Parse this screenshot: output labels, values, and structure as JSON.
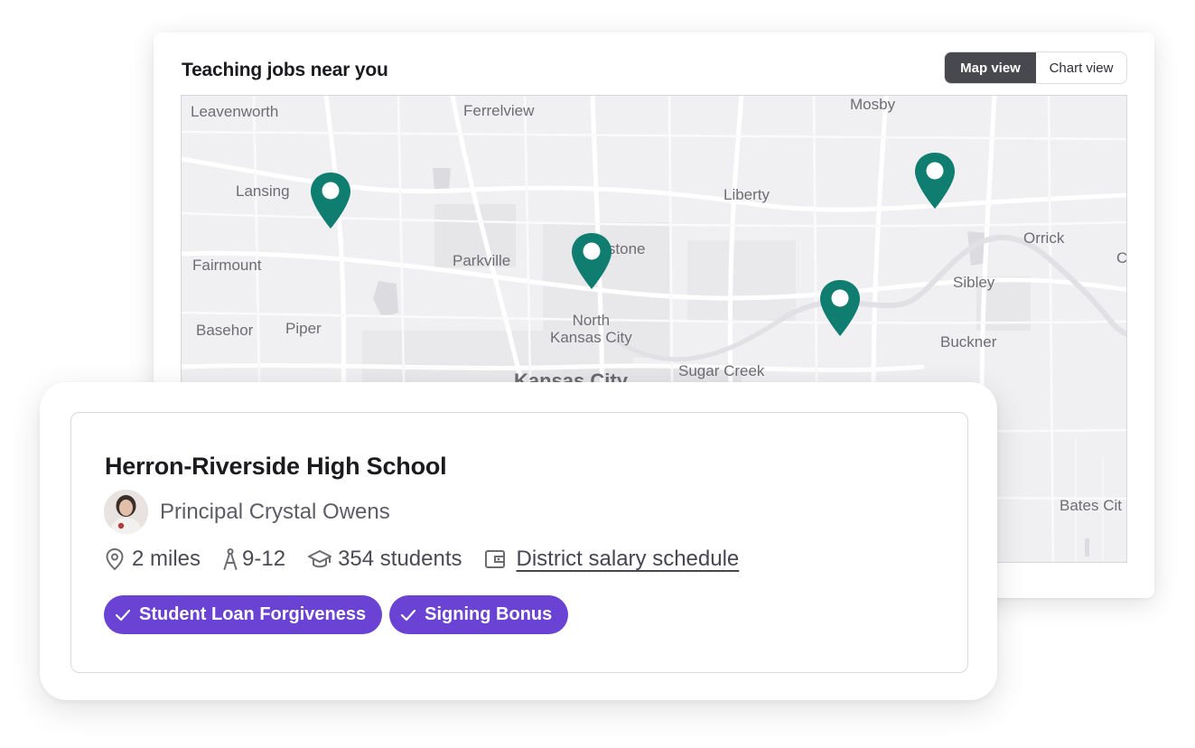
{
  "map_card": {
    "title": "Teaching jobs near you",
    "toggle": {
      "active_label": "Map view",
      "inactive_label": "Chart view"
    },
    "places": [
      {
        "name": "Leavenworth",
        "key": "leavenworth"
      },
      {
        "name": "Ferrelview",
        "key": "ferrelview"
      },
      {
        "name": "Mosby",
        "key": "mosby"
      },
      {
        "name": "Lansing",
        "key": "lansing"
      },
      {
        "name": "Liberty",
        "key": "liberty"
      },
      {
        "name": "Gladstone",
        "key": "gladstone"
      },
      {
        "name": "Orrick",
        "key": "orrick"
      },
      {
        "name": "Fairmount",
        "key": "fairmount"
      },
      {
        "name": "Parkville",
        "key": "parkville"
      },
      {
        "name": "Sibley",
        "key": "sibley"
      },
      {
        "name": "North\nKansas City",
        "key": "north-kansas-city"
      },
      {
        "name": "Basehor",
        "key": "basehor"
      },
      {
        "name": "Piper",
        "key": "piper"
      },
      {
        "name": "Buckner",
        "key": "buckner"
      },
      {
        "name": "Sugar Creek",
        "key": "sugar-creek"
      },
      {
        "name": "Kansas City",
        "key": "kansas-city"
      },
      {
        "name": "Bates Cit",
        "key": "bates-city"
      },
      {
        "name": "C",
        "key": "c-edge"
      }
    ],
    "pin_color": "#0f7d6f"
  },
  "school": {
    "name": "Herron-Riverside High School",
    "principal": "Principal Crystal Owens",
    "distance": "2 miles",
    "grades": "9-12",
    "students": "354 students",
    "salary_link": "District salary schedule",
    "badges": [
      "Student Loan Forgiveness",
      "Signing Bonus"
    ],
    "badge_color": "#6a43d4"
  }
}
